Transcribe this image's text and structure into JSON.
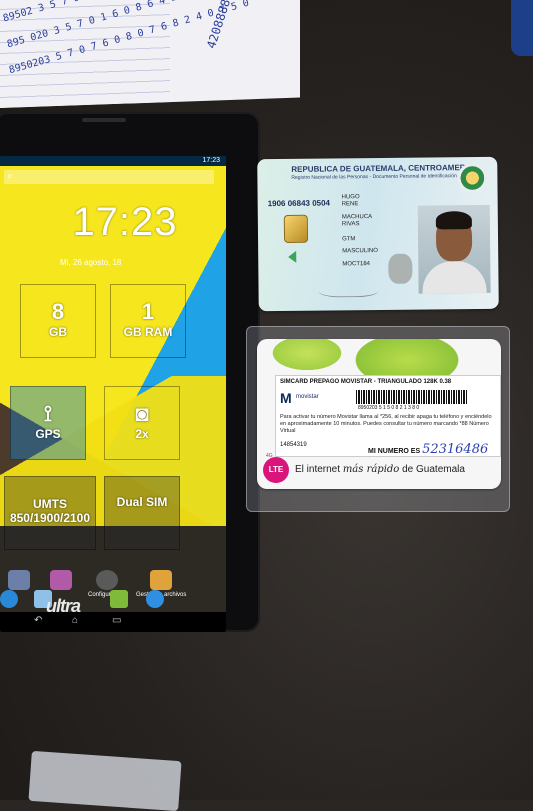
{
  "paper": {
    "scribble_1": "89502 3 5 7 0 8 1 6 0 8 2 4 5 0",
    "scribble_2": "895 020 3 5 7 0 1 6 0 8 6 4 3 0",
    "scribble_3": "8950203 5 7 0 7 6 0 8 0 7 6 8 2 4 0 7 5 0",
    "side_note": "42088889"
  },
  "tablet": {
    "status_time": "17:23",
    "clock": "17:23",
    "date": "Mi, 26 agosto, 18",
    "tiles": [
      {
        "big": "8",
        "small": "GB"
      },
      {
        "big": "1",
        "small": "GB RAM"
      },
      {
        "big": "",
        "small": "GPS"
      },
      {
        "big": "",
        "small": "2x"
      },
      {
        "big": "",
        "small": "UMTS 850/1900/2100"
      },
      {
        "big": "",
        "small": "Dual SIM"
      }
    ],
    "apps": [
      "Configuración",
      "Gestor de archivos"
    ],
    "brand": "ultra"
  },
  "id_card": {
    "title": "REPUBLICA DE GUATEMALA, CENTROAMERICA",
    "subtitle": "Registro Nacional de las Personas - Documento Personal de Identificación (DPI)",
    "cui": "1906 06843 0504",
    "fields": [
      "HUGO",
      "RENE",
      "MACHUCA",
      "RIVAS",
      "GTM",
      "MASCULINO",
      "MOCT184"
    ]
  },
  "sim": {
    "title": "SIMCARD PREPAGO MOVISTAR - TRIANGULADO 128K 0.38",
    "brand": "movistar",
    "serial": "8950203 5 1 5 0 8 2 1 3 8 0",
    "text": "Para activar tu número Movistar llama al *256, al recibir apaga tu teléfono y enciéndelo en aproximadamente 10 minutos. Puedes consultar tu número marcando *88 Número Virtual",
    "virtual_number": "14854319",
    "mi_numero_label": "MI NUMERO ES",
    "handwritten_number": "52316486",
    "lte_badge": "LTE",
    "lte_prefix": "4G",
    "tagline_start": "El internet ",
    "tagline_emph": "más rápido",
    "tagline_end": " de Guatemala"
  }
}
